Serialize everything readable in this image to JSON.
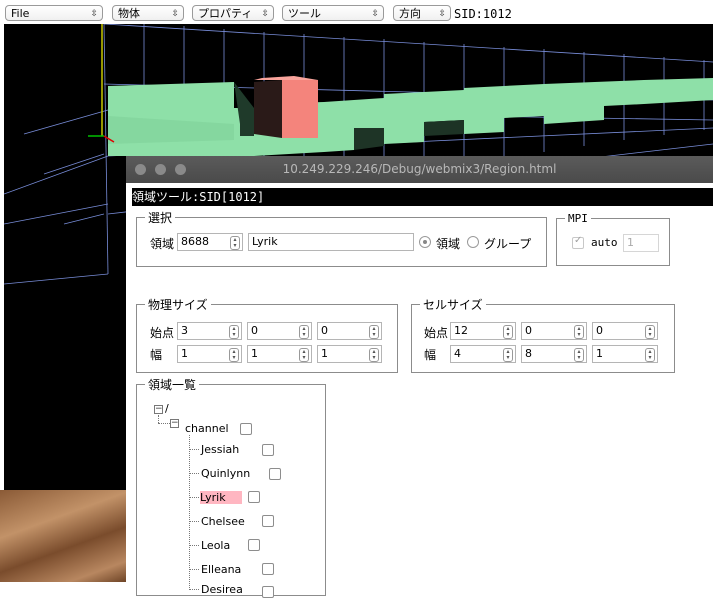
{
  "toolbar": {
    "menus": [
      {
        "label": "File"
      },
      {
        "label": "物体"
      },
      {
        "label": "プロパティ"
      },
      {
        "label": "ツール"
      },
      {
        "label": "方向"
      }
    ],
    "sid": "SID:1012"
  },
  "window": {
    "title": "10.249.229.246/Debug/webmix3/Region.html",
    "heading": "領域ツール:SID[1012]"
  },
  "selection": {
    "legend": "選択",
    "region_label": "領域",
    "region_id": "8688",
    "region_name": "Lyrik",
    "radio_region": "領域",
    "radio_group": "グループ"
  },
  "mpi": {
    "legend": "MPI",
    "auto_label": "auto",
    "value": "1"
  },
  "physical": {
    "legend": "物理サイズ",
    "start_label": "始点",
    "width_label": "幅",
    "start": [
      "3",
      "0",
      "0"
    ],
    "width": [
      "1",
      "1",
      "1"
    ]
  },
  "cell": {
    "legend": "セルサイズ",
    "start_label": "始点",
    "width_label": "幅",
    "start": [
      "12",
      "0",
      "0"
    ],
    "width": [
      "4",
      "8",
      "1"
    ]
  },
  "region_list": {
    "legend": "領域一覧",
    "root": "/",
    "group": "channel",
    "items": [
      "Jessiah",
      "Quinlynn",
      "Lyrik",
      "Chelsee",
      "Leola",
      "Elleana",
      "Desirea"
    ],
    "selected": "Lyrik"
  },
  "colors": {
    "block": "#8ee0a8",
    "selected_block": "#f4847c",
    "grid": "#9fb4ff",
    "highlight": "#ffb6c1"
  }
}
